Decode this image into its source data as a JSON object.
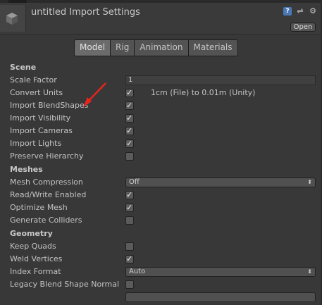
{
  "header": {
    "title": "untitled Import Settings",
    "open_label": "Open",
    "icons": [
      "help-icon",
      "preset-icon",
      "gear-icon"
    ]
  },
  "tabs": [
    {
      "label": "Model",
      "active": true
    },
    {
      "label": "Rig",
      "active": false
    },
    {
      "label": "Animation",
      "active": false
    },
    {
      "label": "Materials",
      "active": false
    }
  ],
  "scene": {
    "heading": "Scene",
    "scale_factor_label": "Scale Factor",
    "scale_factor_value": "1",
    "convert_units_label": "Convert Units",
    "convert_units_checked": true,
    "convert_units_note": "1cm (File) to 0.01m (Unity)",
    "import_blendshapes_label": "Import BlendShapes",
    "import_blendshapes_checked": true,
    "import_visibility_label": "Import Visibility",
    "import_visibility_checked": true,
    "import_cameras_label": "Import Cameras",
    "import_cameras_checked": true,
    "import_lights_label": "Import Lights",
    "import_lights_checked": true,
    "preserve_hierarchy_label": "Preserve Hierarchy",
    "preserve_hierarchy_checked": false
  },
  "meshes": {
    "heading": "Meshes",
    "mesh_compression_label": "Mesh Compression",
    "mesh_compression_value": "Off",
    "read_write_label": "Read/Write Enabled",
    "read_write_checked": true,
    "optimize_mesh_label": "Optimize Mesh",
    "optimize_mesh_checked": true,
    "generate_colliders_label": "Generate Colliders",
    "generate_colliders_checked": false
  },
  "geometry": {
    "heading": "Geometry",
    "keep_quads_label": "Keep Quads",
    "keep_quads_checked": false,
    "weld_vertices_label": "Weld Vertices",
    "weld_vertices_checked": true,
    "index_format_label": "Index Format",
    "index_format_value": "Auto",
    "legacy_blend_label": "Legacy Blend Shape Normal",
    "legacy_blend_checked": false
  },
  "colors": {
    "background": "#383838",
    "annotation_arrow": "#e8241e",
    "help_icon": "#4a78b5"
  }
}
